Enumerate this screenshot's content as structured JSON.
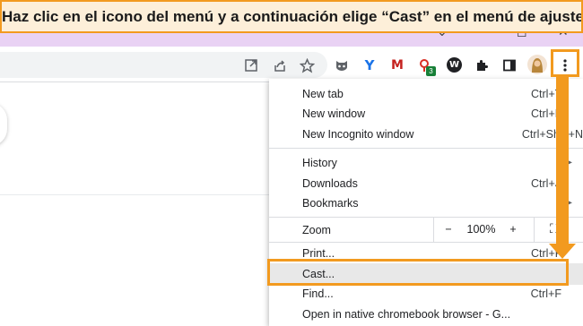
{
  "banner": {
    "text": "Haz clic en el icono del menú y a continuación elige “Cast” en el menú de ajustes"
  },
  "window_controls": {
    "minimize": "⌄",
    "maximize": "◻",
    "close": "✕"
  },
  "toolbar": {
    "icons": [
      "open-in-new-window-icon",
      "share-icon",
      "bookmark-star-icon",
      "extension-mask-icon",
      "extension-y-icon",
      "extension-m-icon",
      "extension-badge-icon",
      "extension-w-icon",
      "extensions-puzzle-icon",
      "side-panel-icon",
      "profile-avatar",
      "kebab-menu-icon"
    ],
    "badge_count": "3",
    "ext_w": "W",
    "ext_y": "Y",
    "ext_m": "M"
  },
  "menu": {
    "new_tab": {
      "label": "New tab",
      "shortcut": "Ctrl+T"
    },
    "new_window": {
      "label": "New window",
      "shortcut": "Ctrl+N"
    },
    "new_incognito": {
      "label": "New Incognito window",
      "shortcut": "Ctrl+Shift+N"
    },
    "history": {
      "label": "History"
    },
    "downloads": {
      "label": "Downloads",
      "shortcut": "Ctrl+J"
    },
    "bookmarks": {
      "label": "Bookmarks"
    },
    "zoom": {
      "label": "Zoom",
      "minus": "−",
      "value": "100%",
      "plus": "+",
      "fullscreen": "⛶"
    },
    "print": {
      "label": "Print...",
      "shortcut": "Ctrl+P"
    },
    "cast": {
      "label": "Cast..."
    },
    "find": {
      "label": "Find...",
      "shortcut": "Ctrl+F"
    },
    "open_native": {
      "label": "Open in native chromebook browser - G..."
    }
  },
  "accent_color": "#f29a1f"
}
